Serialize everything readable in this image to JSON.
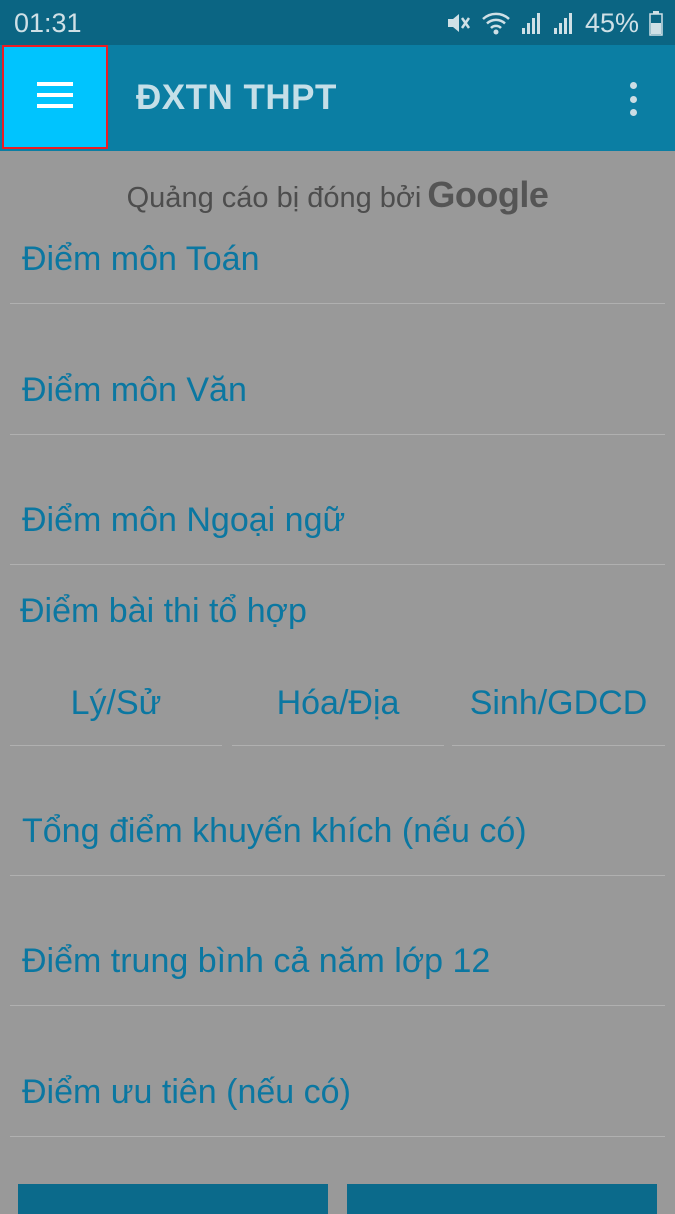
{
  "status_bar": {
    "time": "01:31",
    "battery": "45%",
    "icons": [
      "mute-icon",
      "wifi-icon",
      "signal-icon",
      "signal-icon",
      "battery-icon"
    ]
  },
  "app_bar": {
    "title": "ĐXTN THPT",
    "menu_icon": "hamburger-menu-icon",
    "overflow_icon": "more-vertical-icon"
  },
  "ad_notice": {
    "text": "Quảng cáo bị đóng bởi",
    "brand": "Google"
  },
  "form": {
    "toan": "Điểm môn Toán",
    "van": "Điểm môn Văn",
    "ngoai_ngu": "Điểm môn Ngoại ngữ",
    "to_hop_heading": "Điểm bài thi tổ hợp",
    "to_hop": [
      "Lý/Sử",
      "Hóa/Địa",
      "Sinh/GDCD"
    ],
    "khuyen_khich": "Tổng điểm khuyến khích (nếu có)",
    "trung_binh": "Điểm trung bình cả năm lớp 12",
    "uu_tien": "Điểm ưu tiên (nếu có)"
  },
  "colors": {
    "accent": "#0b77a1",
    "app_bar": "#0b7ea3",
    "menu_highlight": "#00c4fe",
    "highlight_border": "#ec1c24"
  }
}
